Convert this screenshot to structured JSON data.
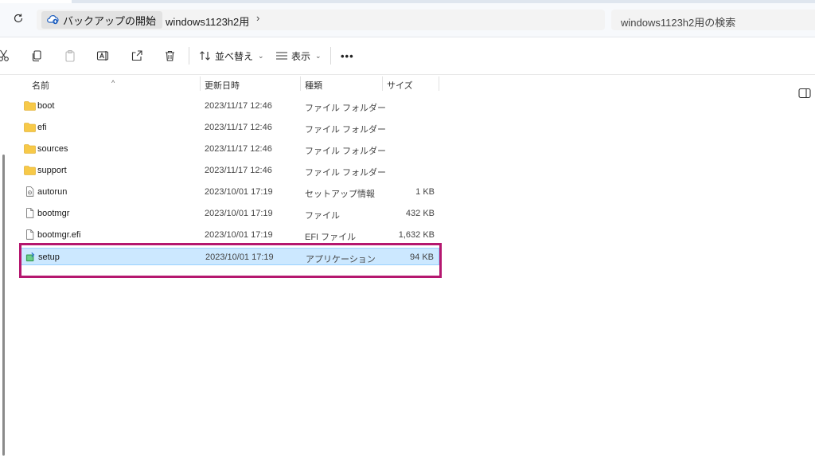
{
  "address": {
    "home_label": "バックアップの開始",
    "crumbs": [
      "windows1123h2用"
    ]
  },
  "search": {
    "placeholder": "windows1123h2用の検索"
  },
  "toolbar": {
    "sort_label": "並べ替え",
    "view_label": "表示",
    "more_label": "•••"
  },
  "columns": {
    "name": "名前",
    "date": "更新日時",
    "type": "種類",
    "size": "サイズ"
  },
  "files": [
    {
      "name": "boot",
      "date": "2023/11/17 12:46",
      "type": "ファイル フォルダー",
      "size": "",
      "icon": "folder-icon"
    },
    {
      "name": "efi",
      "date": "2023/11/17 12:46",
      "type": "ファイル フォルダー",
      "size": "",
      "icon": "folder-icon"
    },
    {
      "name": "sources",
      "date": "2023/11/17 12:46",
      "type": "ファイル フォルダー",
      "size": "",
      "icon": "folder-icon"
    },
    {
      "name": "support",
      "date": "2023/11/17 12:46",
      "type": "ファイル フォルダー",
      "size": "",
      "icon": "folder-icon"
    },
    {
      "name": "autorun",
      "date": "2023/10/01 17:19",
      "type": "セットアップ情報",
      "size": "1 KB",
      "icon": "setup-info-icon"
    },
    {
      "name": "bootmgr",
      "date": "2023/10/01 17:19",
      "type": "ファイル",
      "size": "432 KB",
      "icon": "file-icon"
    },
    {
      "name": "bootmgr.efi",
      "date": "2023/10/01 17:19",
      "type": "EFI ファイル",
      "size": "1,632 KB",
      "icon": "file-icon"
    },
    {
      "name": "setup",
      "date": "2023/10/01 17:19",
      "type": "アプリケーション",
      "size": "94 KB",
      "icon": "setup-app-icon",
      "selected": true
    }
  ],
  "colors": {
    "folder": "#f7c948",
    "selection_bg": "#cce8ff",
    "highlight_border": "#b5176f"
  }
}
